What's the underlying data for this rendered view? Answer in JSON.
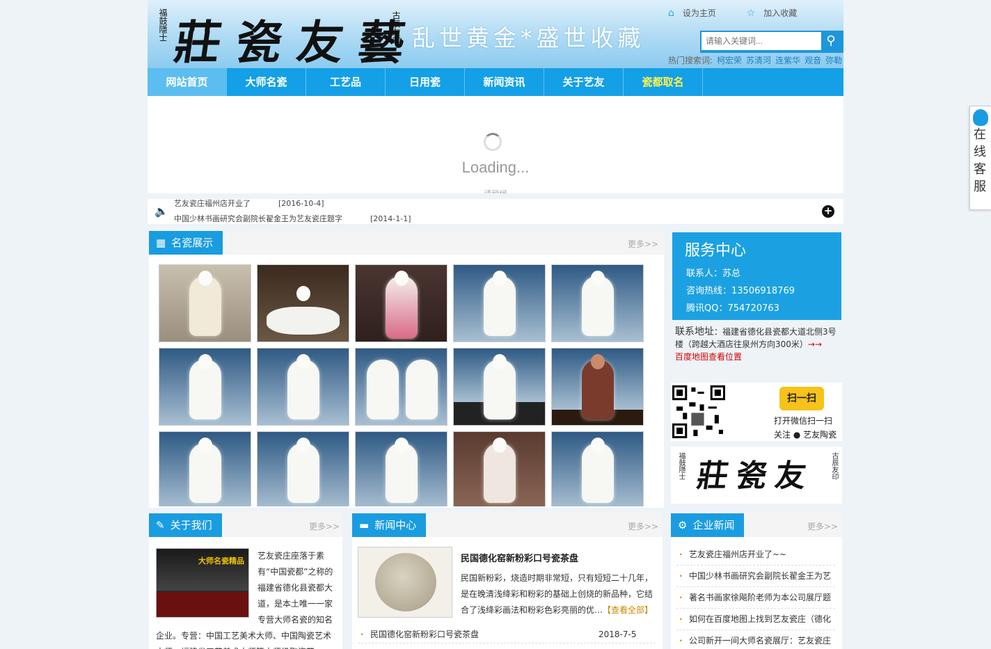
{
  "header": {
    "logo_main": "莊瓷友藝",
    "logo_left_seal": "福鼓隱士",
    "logo_right_seal": "古辰友印",
    "slogan": "乱世黄金*盛世收藏",
    "set_home": "设为主页",
    "add_fav": "加入收藏",
    "search_placeholder": "请输入关键词...",
    "hot_label": "热门搜索词:",
    "hot_words": [
      "柯宏荣",
      "苏清河",
      "连紫华",
      "观音",
      "弥勒"
    ]
  },
  "nav": [
    "网站首页",
    "大师名瓷",
    "工艺品",
    "日用瓷",
    "新闻资讯",
    "关于艺友",
    "瓷都取名"
  ],
  "banner": {
    "loading": "Loading...",
    "sub": "请稍候"
  },
  "notice": {
    "line1": "艺友瓷庄福州店开业了",
    "line1_date": "[2016-10-4]",
    "line2": "中国少林书画研究会副院长翟金王为艺友瓷庄题字",
    "line2_date": "[2014-1-1]"
  },
  "gallery": {
    "title": "名瓷展示",
    "more": "更多>>"
  },
  "service": {
    "title": "服务中心",
    "contact": "联系人：苏总",
    "phone": "咨询热线：13506918769",
    "qq": "腾讯QQ：754720763",
    "addr_label": "联系地址",
    "addr": "：福建省德化县瓷都大道北侧3号楼（跨越大酒店往泉州方向300米）",
    "arrow": "→→",
    "map": "百度地图查看位置",
    "scan_btn": "扫一扫",
    "scan1": "打开微信扫一扫",
    "scan2": "关注 ● 艺友陶瓷"
  },
  "about": {
    "title": "关于我们",
    "more": "更多>>",
    "text": "艺友瓷庄座落于素有“中国瓷都”之称的福建省德化县瓷都大道，是本土唯一一家专营大师名瓷的知名企业。专营：中国工艺美术大师、中国陶瓷艺术大师，福建省工艺美术大师等大师级陶瓷艺",
    "sign": "大师名瓷精品"
  },
  "news": {
    "title": "新闻中心",
    "more": "更多>>",
    "headline": "民国德化窑新粉彩口号瓷茶盘",
    "desc": "民国新粉彩，烧造时期非常短，只有短短二十几年，是在晚清浅绛彩和粉彩的基础上创烧的新品种，它结合了浅绛彩画法和粉彩色彩亮丽的优…",
    "view_all": "【查看全部】",
    "items": [
      {
        "title": "民国德化窑新粉彩口号瓷茶盘",
        "date": "2018-7-5"
      }
    ]
  },
  "corp": {
    "title": "企业新闻",
    "more": "更多>>",
    "items": [
      "艺友瓷庄福州店开业了~~",
      "中国少林书画研究会副院长翟金王为艺",
      "著名书画家徐飚阶老师为本公司展厅题",
      "如何在百度地图上找到艺友瓷庄（德化",
      "公司新开一间大师名瓷展厅：艺友瓷庄"
    ]
  },
  "kefu": "在线客服",
  "colors": {
    "primary": "#1a9ce0",
    "nav_highlight": "#fff34c",
    "accent_orange": "#f08000"
  }
}
